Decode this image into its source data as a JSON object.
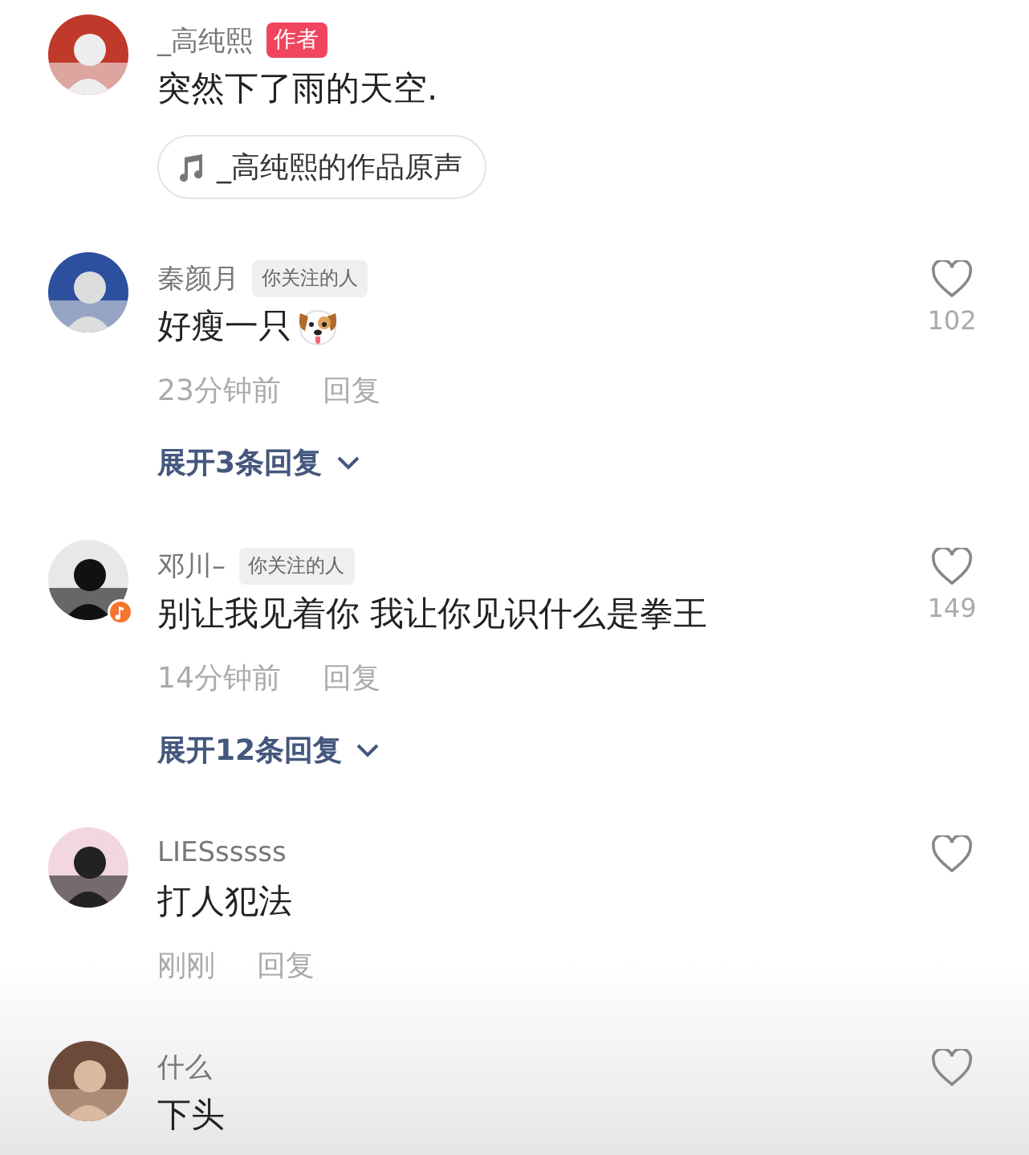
{
  "comments": [
    {
      "name": "_高纯熙",
      "tag": {
        "text": "作者",
        "kind": "author"
      },
      "text": "突然下了雨的天空.",
      "sticker": false,
      "music_badge": false,
      "sound_chip": "_高纯熙的作品原声",
      "like_button": false
    },
    {
      "name": "秦颜月",
      "tag": {
        "text": "你关注的人",
        "kind": "following"
      },
      "text": "好瘦一只",
      "sticker": true,
      "music_badge": false,
      "time": "23分钟前",
      "reply": "回复",
      "expand": "展开3条回复",
      "like_button": true,
      "likes": "102"
    },
    {
      "name": "邓川–",
      "tag": {
        "text": "你关注的人",
        "kind": "following"
      },
      "text": "别让我见着你 我让你见识什么是拳王",
      "sticker": false,
      "music_badge": true,
      "time": "14分钟前",
      "reply": "回复",
      "expand": "展开12条回复",
      "like_button": true,
      "likes": "149"
    },
    {
      "name": "LIESsssss",
      "text": "打人犯法",
      "sticker": false,
      "music_badge": false,
      "time": "刚刚",
      "reply": "回复",
      "like_button": true
    },
    {
      "name": "什么",
      "text": "下头",
      "sticker": false,
      "music_badge": false,
      "like_button": true
    }
  ]
}
